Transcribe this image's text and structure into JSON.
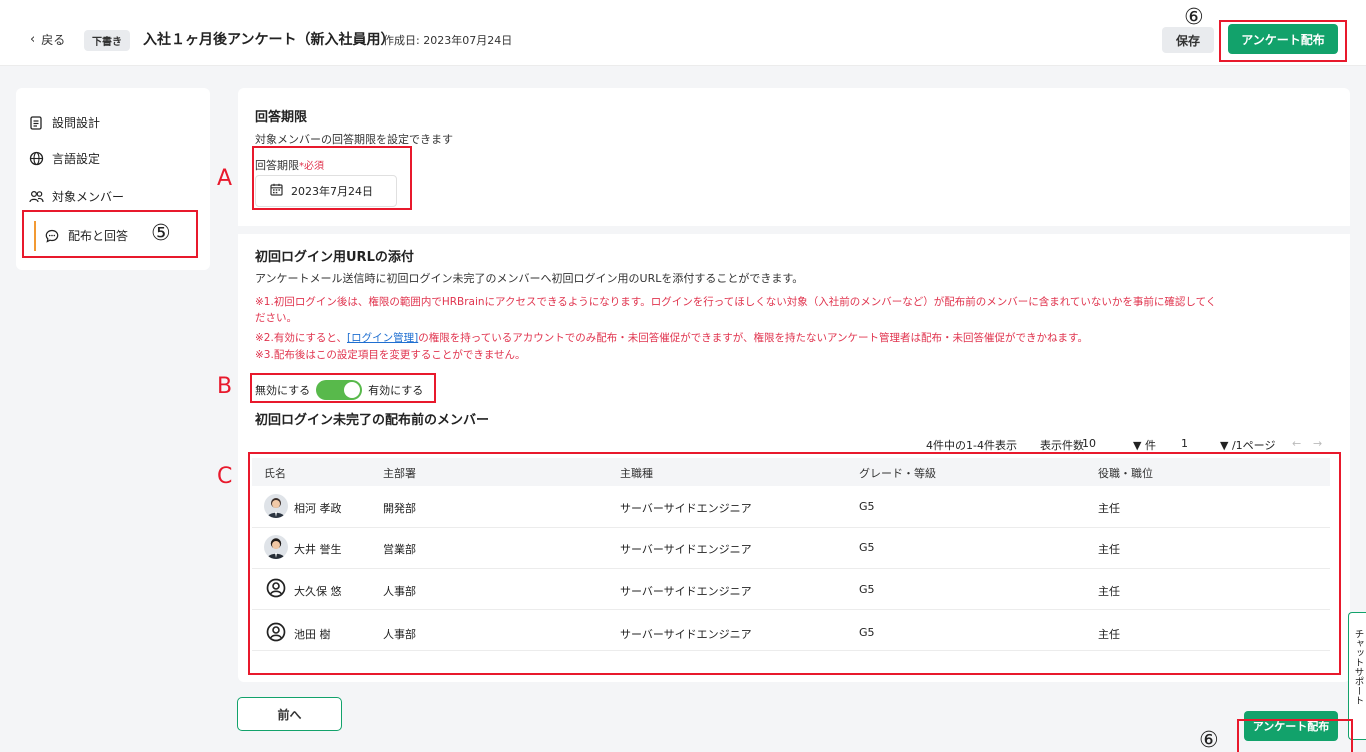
{
  "header": {
    "back_label": "戻る",
    "draft_badge": "下書き",
    "title": "入社１ヶ月後アンケート（新入社員用）",
    "created": "作成日: 2023年07月24日",
    "save_label": "保存",
    "distribute_label": "アンケート配布"
  },
  "sidebar": {
    "items": [
      {
        "label": "設問設計",
        "icon": "document-icon"
      },
      {
        "label": "言語設定",
        "icon": "globe-icon"
      },
      {
        "label": "対象メンバー",
        "icon": "users-icon"
      },
      {
        "label": "配布と回答",
        "icon": "chat-icon"
      }
    ]
  },
  "deadline": {
    "title": "回答期限",
    "description": "対象メンバーの回答期限を設定できます",
    "field_label": "回答期限",
    "required_mark": "*必須",
    "date_value": "2023年7月24日"
  },
  "login_url": {
    "title": "初回ログイン用URLの添付",
    "description": "アンケートメール送信時に初回ログイン未完了のメンバーへ初回ログイン用のURLを添付することができます。",
    "note1_line1": "※1.初回ログイン後は、権限の範囲内でHRBrainにアクセスできるようになります。ログインを行ってほしくない対象（入社前のメンバーなど）が配布前のメンバーに含まれていないかを事前に確認してく",
    "note1_line2": "ださい。",
    "note2_before": "※2.有効にすると、",
    "note2_link": "[ログイン管理]",
    "note2_after": "の権限を持っているアカウントでのみ配布・未回答催促ができますが、権限を持たないアンケート管理者は配布・未回答催促ができかねます。",
    "note3": "※3.配布後はこの設定項目を変更することができません。",
    "toggle_off_label": "無効にする",
    "toggle_on_label": "有効にする"
  },
  "members": {
    "title": "初回ログイン未完了の配布前のメンバー",
    "pager": {
      "summary": "4件中の1-4件表示",
      "per_page_label": "表示件数",
      "per_page_value": "10",
      "page_unit": "▼ 件",
      "page_value": "1",
      "total_pages": "▼ /1ページ",
      "prev_arrow": "←",
      "next_arrow": "→"
    },
    "columns": [
      "氏名",
      "主部署",
      "主職種",
      "グレード・等級",
      "役職・職位"
    ],
    "rows": [
      {
        "name": "相河 孝政",
        "dept": "開発部",
        "job": "サーバーサイドエンジニア",
        "grade": "G5",
        "position": "主任",
        "avatar": "photo"
      },
      {
        "name": "大井 誉生",
        "dept": "営業部",
        "job": "サーバーサイドエンジニア",
        "grade": "G5",
        "position": "主任",
        "avatar": "photo"
      },
      {
        "name": "大久保 悠",
        "dept": "人事部",
        "job": "サーバーサイドエンジニア",
        "grade": "G5",
        "position": "主任",
        "avatar": "default"
      },
      {
        "name": "池田 樹",
        "dept": "人事部",
        "job": "サーバーサイドエンジニア",
        "grade": "G5",
        "position": "主任",
        "avatar": "default"
      }
    ]
  },
  "footer": {
    "prev_label": "前へ",
    "distribute_label": "アンケート配布"
  },
  "chat_support_label": "チャットサポート",
  "annotations": {
    "a": "A",
    "b": "B",
    "c": "C",
    "five": "⑤",
    "six": "⑥"
  },
  "colors": {
    "accent": "#12a26b",
    "toggle_on": "#58b94b",
    "warning_text": "#e0344e",
    "annotation_red": "#e8192c"
  }
}
